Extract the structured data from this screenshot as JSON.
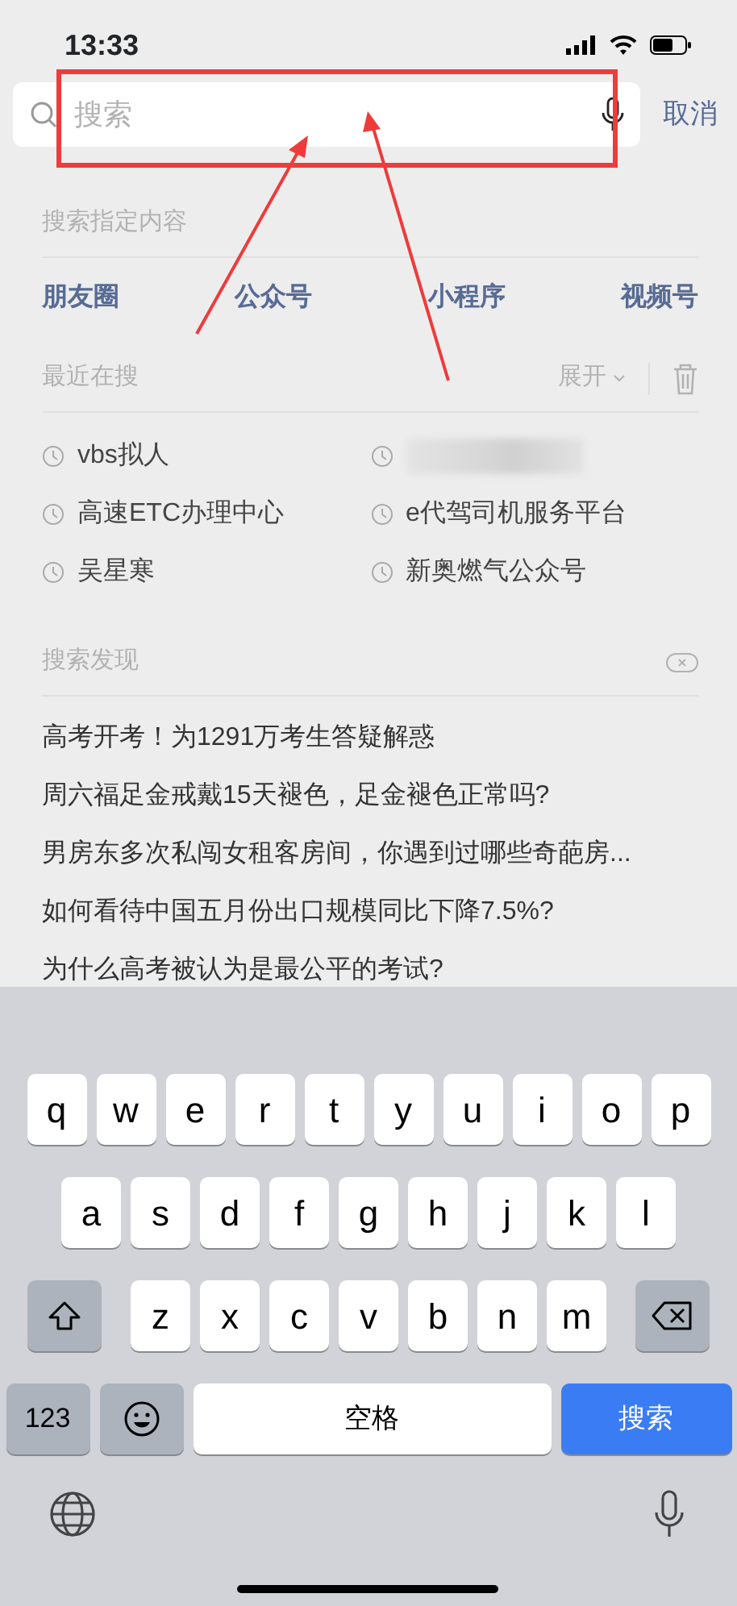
{
  "status_bar": {
    "time": "13:33"
  },
  "search": {
    "placeholder": "搜索",
    "cancel": "取消"
  },
  "annotation": {
    "highlight": true
  },
  "specific": {
    "title": "搜索指定内容",
    "items": [
      "朋友圈",
      "公众号",
      "小程序",
      "视频号"
    ]
  },
  "recent": {
    "title": "最近在搜",
    "expand": "展开",
    "items": [
      {
        "kind": "text",
        "text": "vbs拟人"
      },
      {
        "kind": "blurred"
      },
      {
        "kind": "text",
        "text": "高速ETC办理中心"
      },
      {
        "kind": "text",
        "text": "e代驾司机服务平台"
      },
      {
        "kind": "text",
        "text": "吴星寒"
      },
      {
        "kind": "text",
        "text": "新奥燃气公众号"
      }
    ]
  },
  "discover": {
    "title": "搜索发现",
    "items": [
      "高考开考！为1291万考生答疑解惑",
      "周六福足金戒戴15天褪色，足金褪色正常吗?",
      "男房东多次私闯女租客房间，你遇到过哪些奇葩房...",
      "如何看待中国五月份出口规模同比下降7.5%?",
      "为什么高考被认为是最公平的考试?"
    ]
  },
  "keyboard": {
    "rows": [
      [
        "q",
        "w",
        "e",
        "r",
        "t",
        "y",
        "u",
        "i",
        "o",
        "p"
      ],
      [
        "a",
        "s",
        "d",
        "f",
        "g",
        "h",
        "j",
        "k",
        "l"
      ],
      [
        "z",
        "x",
        "c",
        "v",
        "b",
        "n",
        "m"
      ]
    ],
    "numbers": "123",
    "space": "空格",
    "return": "搜索"
  }
}
